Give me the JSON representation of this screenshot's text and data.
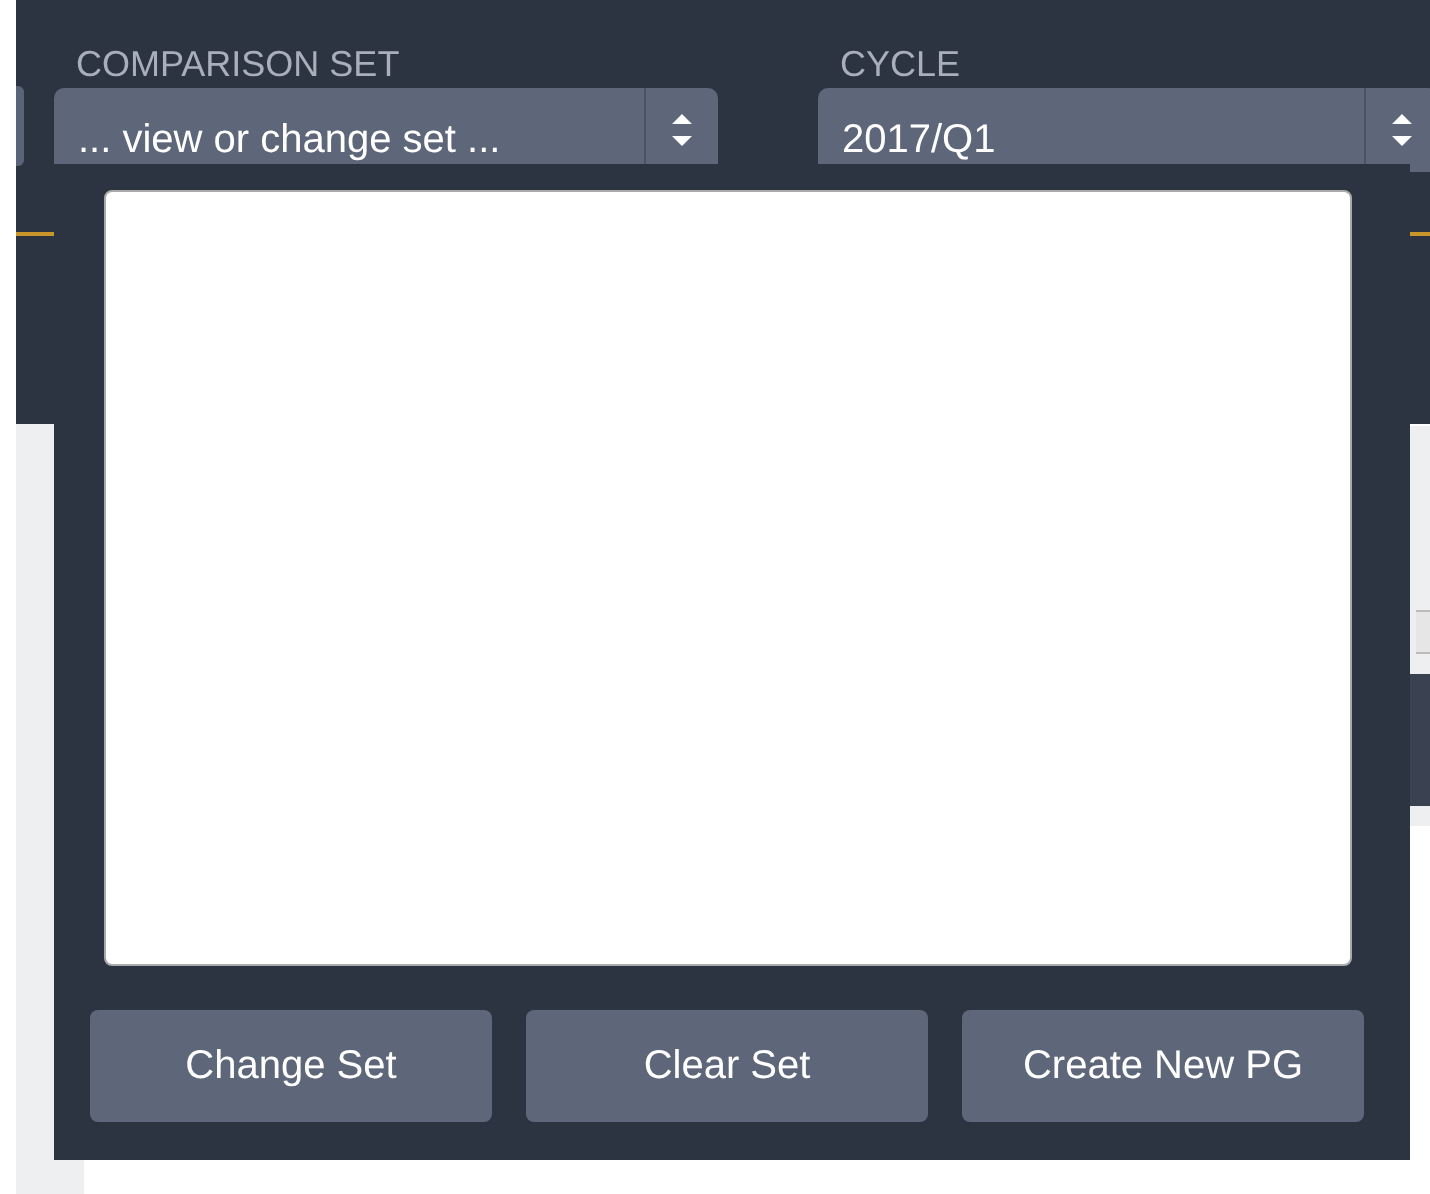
{
  "filters": [
    {
      "label": "COMPARISON SET",
      "value": "... view or change set ...",
      "kind": "stepper"
    },
    {
      "label": "CYCLE",
      "value": "2017/Q1",
      "kind": "stepper"
    }
  ],
  "popup": {
    "buttons": [
      "Change Set",
      "Clear Set",
      "Create New PG"
    ]
  }
}
